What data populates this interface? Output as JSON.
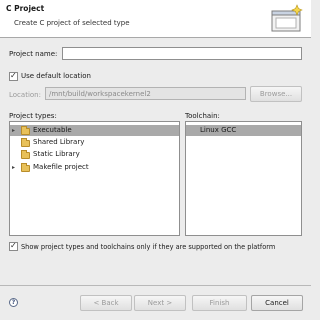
{
  "header": {
    "title": "C Project",
    "description": "Create C project of selected type",
    "icon": "new-project-wizard-icon"
  },
  "form": {
    "project_name_label": "Project name:",
    "project_name_value": "",
    "use_default_location_label": "Use default location",
    "use_default_location_checked": true,
    "location_label": "Location:",
    "location_value": "/mnt/build/workspacekernel2",
    "browse_label": "Browse..."
  },
  "project_types": {
    "label": "Project types:",
    "items": [
      {
        "label": "Executable",
        "expander": "▸",
        "selected": true
      },
      {
        "label": "Shared Library",
        "expander": "",
        "selected": false
      },
      {
        "label": "Static Library",
        "expander": "",
        "selected": false
      },
      {
        "label": "Makefile project",
        "expander": "▸",
        "selected": false
      }
    ]
  },
  "toolchains": {
    "label": "Toolchain:",
    "items": [
      {
        "label": "Linux GCC",
        "selected": true
      }
    ]
  },
  "filter": {
    "label": "Show project types and toolchains only if they are supported on the platform",
    "checked": true
  },
  "buttons": {
    "back": "< Back",
    "next": "Next >",
    "finish": "Finish",
    "cancel": "Cancel"
  },
  "colors": {
    "selection": "#a9a9a9",
    "folder": "#e8c15a"
  }
}
